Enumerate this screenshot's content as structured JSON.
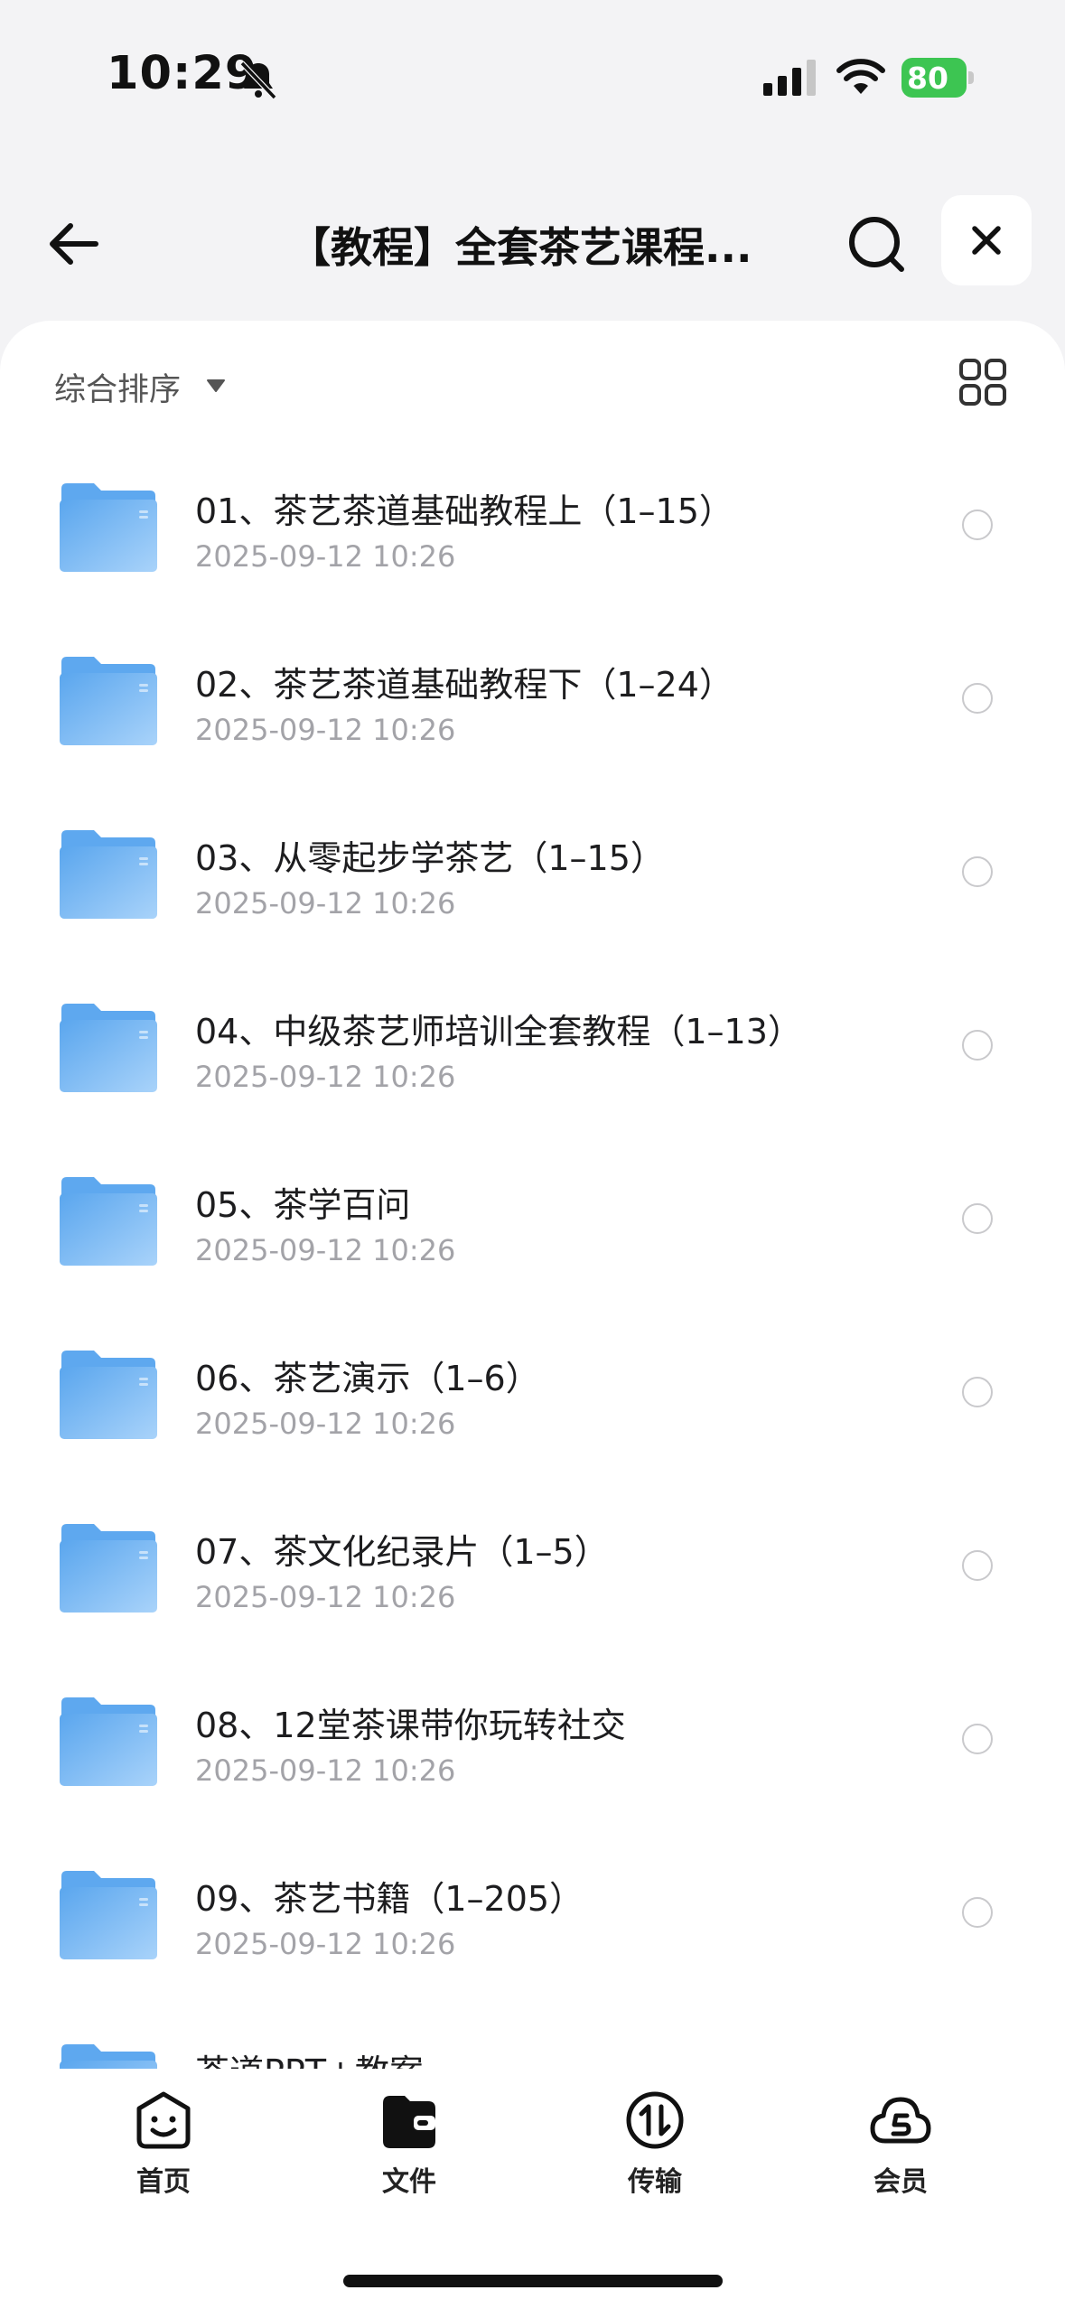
{
  "status": {
    "time": "10:29",
    "battery": "80"
  },
  "header": {
    "title": "【教程】全套茶艺课程..."
  },
  "toolbar": {
    "sort_label": "综合排序"
  },
  "files": [
    {
      "name": "01、茶艺茶道基础教程上（1–15）",
      "date": "2025-09-12 10:26"
    },
    {
      "name": "02、茶艺茶道基础教程下（1–24）",
      "date": "2025-09-12 10:26"
    },
    {
      "name": "03、从零起步学茶艺（1–15）",
      "date": "2025-09-12 10:26"
    },
    {
      "name": "04、中级茶艺师培训全套教程（1–13）",
      "date": "2025-09-12 10:26"
    },
    {
      "name": "05、茶学百问",
      "date": "2025-09-12 10:26"
    },
    {
      "name": "06、茶艺演示（1–6）",
      "date": "2025-09-12 10:26"
    },
    {
      "name": "07、茶文化纪录片（1–5）",
      "date": "2025-09-12 10:26"
    },
    {
      "name": "08、12堂茶课带你玩转社交",
      "date": "2025-09-12 10:26"
    },
    {
      "name": "09、茶艺书籍（1–205）",
      "date": "2025-09-12 10:26"
    },
    {
      "name": "茶道PPT+教案",
      "date": ""
    }
  ],
  "tabs": [
    {
      "label": "首页",
      "icon": "smiley-home-icon"
    },
    {
      "label": "文件",
      "icon": "wallet-folder-icon",
      "active": true
    },
    {
      "label": "传输",
      "icon": "transfer-arrows-icon"
    },
    {
      "label": "会员",
      "icon": "cloud-member-icon"
    }
  ],
  "colors": {
    "folder": "#6fb3f2",
    "accent": "#3dc552",
    "background": "#f3f3f5"
  }
}
